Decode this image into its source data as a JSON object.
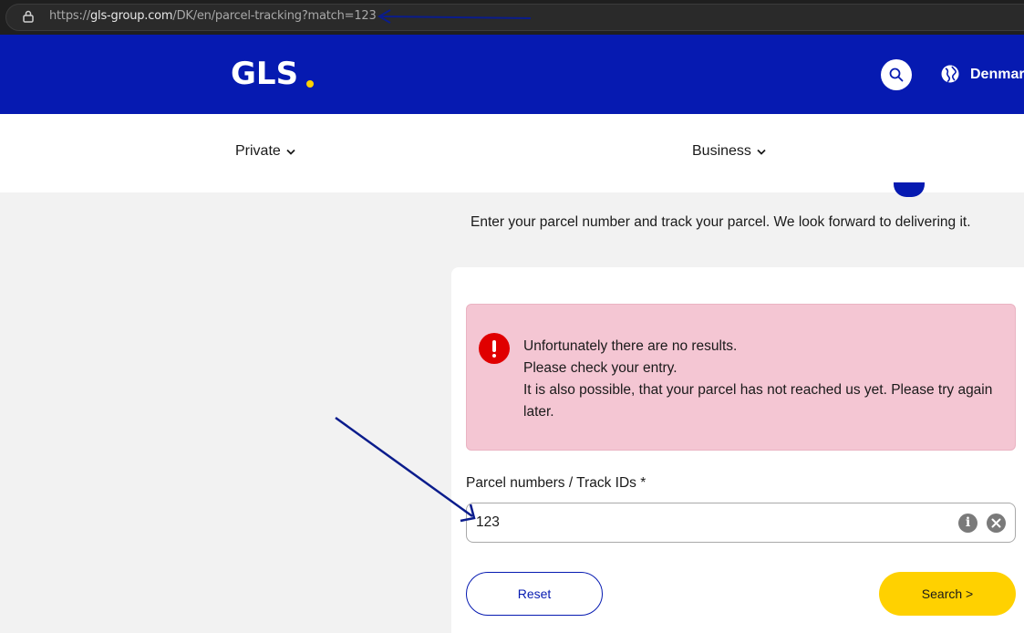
{
  "browser": {
    "url_prefix": "https://",
    "url_host": "gls-group.com",
    "url_path": "/DK/en/parcel-tracking?match=123"
  },
  "header": {
    "logo": "GLS",
    "country": "Denmark",
    "brand_color": "#061ab1",
    "accent_color": "#ffd100"
  },
  "nav": {
    "private_label": "Private",
    "business_label": "Business"
  },
  "intro": "Enter your parcel number and track your parcel. We look forward to delivering it.",
  "alert": {
    "icon": "exclamation-icon",
    "lines": [
      "Unfortunately there are no results.",
      "Please check your entry.",
      "It is also possible, that your parcel has not reached us yet. Please try again later."
    ]
  },
  "form": {
    "label": "Parcel numbers / Track IDs *",
    "value": "123",
    "info_symbol": "i",
    "reset_label": "Reset",
    "search_label": "Search >"
  }
}
